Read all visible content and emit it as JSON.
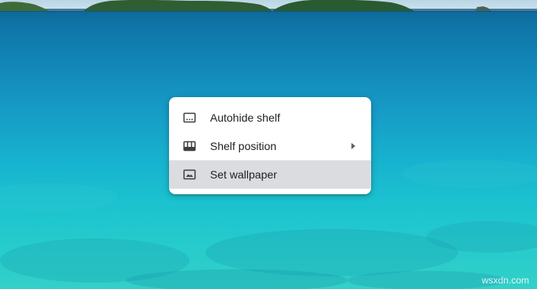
{
  "context_menu": {
    "items": [
      {
        "label": "Autohide shelf",
        "icon": "autohide-shelf-icon",
        "has_submenu": false,
        "highlighted": false
      },
      {
        "label": "Shelf position",
        "icon": "shelf-position-icon",
        "has_submenu": true,
        "highlighted": false
      },
      {
        "label": "Set wallpaper",
        "icon": "wallpaper-icon",
        "has_submenu": false,
        "highlighted": true
      }
    ]
  },
  "watermark": "wsxdn.com",
  "colors": {
    "menu_background": "#ffffff",
    "highlight": "#dadce0",
    "text": "#202124",
    "icon": "#3c4043"
  }
}
